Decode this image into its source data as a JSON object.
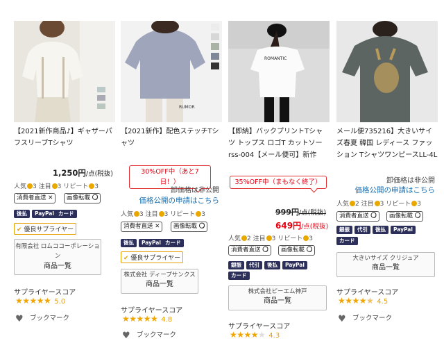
{
  "products": [
    {
      "title": "【2021新作商品♪】ギャザーパフスリーブTシャツ",
      "price": "1,250円",
      "price_unit": "/点(税抜)",
      "points": {
        "ninki": "人気",
        "ninki_n": "3",
        "chumoku": "注目",
        "chumoku_n": "3",
        "repeat": "リピート",
        "repeat_n": "3"
      },
      "tags": {
        "direct": "消費者直送",
        "direct_mark": "✕",
        "image": "画像転載",
        "image_mark": "〇",
        "card1": "後払",
        "card2": "PayPal",
        "card3": "カード"
      },
      "premium": "優良サプライヤー",
      "seller_name": "有限会社 ロムココーポレーション",
      "seller_btn": "商品一覧",
      "score_label": "サプライヤースコア",
      "score": "5.0",
      "score_value": 5.0,
      "bookmark": "ブックマーク"
    },
    {
      "title": "【2021新作】配色ステッチTシャツ",
      "sale": "30%OFF中（あと7日！）",
      "wholesale1": "卸価格は非公開",
      "wholesale2": "価格公開の申請はこちら",
      "points": {
        "ninki": "人気",
        "ninki_n": "3",
        "chumoku": "注目",
        "chumoku_n": "3",
        "repeat": "リピート",
        "repeat_n": "3"
      },
      "tags": {
        "direct": "消費者直送",
        "direct_mark": "✕",
        "image": "画像転載",
        "image_mark": "〇",
        "card1": "後払",
        "card2": "PayPal",
        "card3": "カード"
      },
      "premium": "優良サプライヤー",
      "seller_name": "株式会社 ディープサンクス",
      "seller_btn": "商品一覧",
      "score_label": "サプライヤースコア",
      "score": "4.8",
      "score_value": 4.8,
      "bookmark": "ブックマーク"
    },
    {
      "title": "【即納】バックプリントTシャツ トップス ロゴT カットソー rss-004【メール便可】新作",
      "sale": "35%OFF中（まもなく終了）",
      "old_price": "999円",
      "old_unit": "/点(税抜)",
      "price": "649円",
      "price_unit": "/点(税抜)",
      "points": {
        "ninki": "人気",
        "ninki_n": "2",
        "chumoku": "注目",
        "chumoku_n": "3",
        "repeat": "リピート",
        "repeat_n": "3"
      },
      "tags": {
        "direct": "消費者直送",
        "direct_mark": "〇",
        "image": "画像転載",
        "image_mark": "〇",
        "card0a": "銀振",
        "card0b": "代引",
        "card1": "後払",
        "card2": "PayPal",
        "card3": "カード"
      },
      "seller_name": "株式会社ピーエム神戸",
      "seller_btn": "商品一覧",
      "score_label": "サプライヤースコア",
      "score": "4.3",
      "score_value": 4.3
    },
    {
      "title": "メール便735216】大きいサイズ春夏 韓国 レディース ファッション TシャツワンピースLL-4L",
      "wholesale1": "卸価格は非公開",
      "wholesale2": "価格公開の申請はこちら",
      "points": {
        "ninki": "人気",
        "ninki_n": "2",
        "chumoku": "注目",
        "chumoku_n": "3",
        "repeat": "リピート",
        "repeat_n": "3"
      },
      "tags": {
        "direct": "消費者直送",
        "direct_mark": "〇",
        "image": "画像転載",
        "image_mark": "〇",
        "card0a": "銀振",
        "card0b": "代引",
        "card1": "後払",
        "card2": "PayPal",
        "card3": "カード"
      },
      "seller_name": "大きいサイズ クリジュア",
      "seller_btn": "商品一覧",
      "score_label": "サプライヤースコア",
      "score": "4.5",
      "score_value": 4.5,
      "bookmark": "ブックマーク"
    }
  ]
}
